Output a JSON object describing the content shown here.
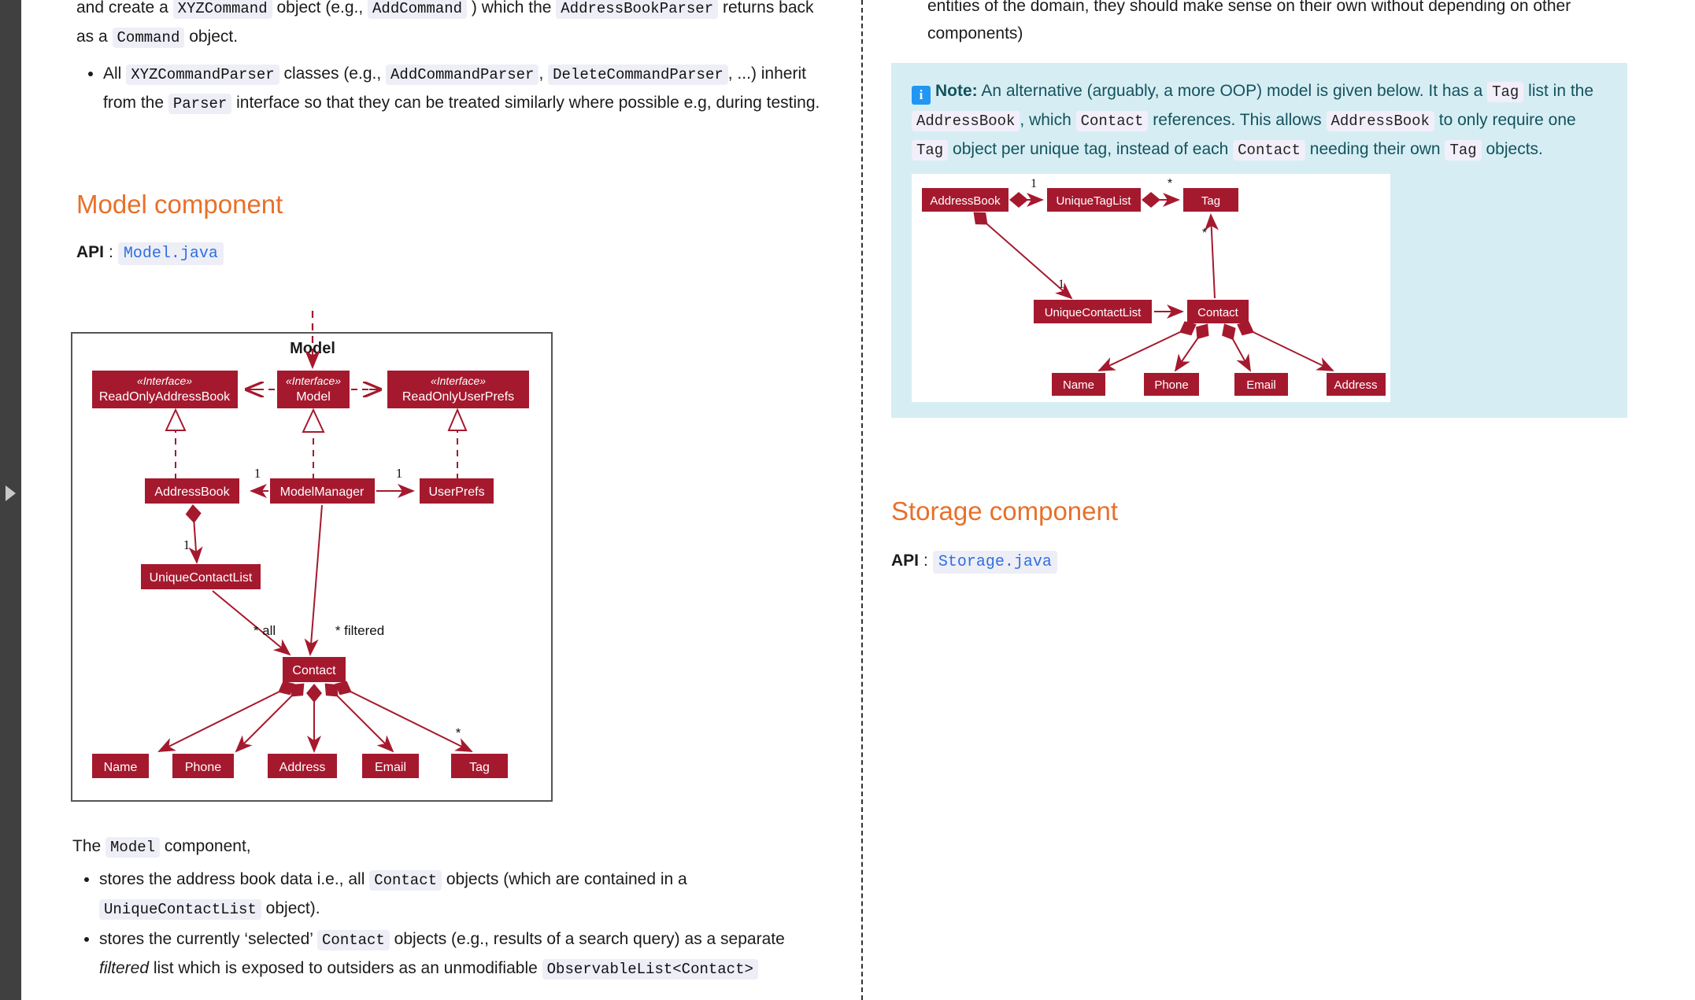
{
  "left_rail": {
    "toggle_icon": "triangle-right-icon"
  },
  "left_column": {
    "intro_paragraph": {
      "t1": "and create a ",
      "c1": "XYZCommand",
      "t2": " object (e.g., ",
      "c2": "AddCommand",
      "t3": " ) which the ",
      "c3": "AddressBookParser",
      "t4": " returns back as a ",
      "c4": "Command",
      "t5": " object."
    },
    "bullet_parser": {
      "t1": "All ",
      "c1": "XYZCommandParser",
      "t2": " classes (e.g., ",
      "c2": "AddCommandParser",
      "t3": ", ",
      "c3": "DeleteCommandParser",
      "t4": ", ...) inherit from the ",
      "c4": "Parser",
      "t5": " interface so that they can be treated similarly where possible e.g, during testing."
    },
    "section_heading": "Model component",
    "api_label": "API",
    "api_sep": ":",
    "api_file": "Model.java",
    "closing_lead": {
      "t1": "The ",
      "c1": "Model",
      "t2": " component,"
    },
    "closing_bullets": [
      {
        "t1": "stores the address book data i.e., all ",
        "c1": "Contact",
        "t2": " objects (which are contained in a ",
        "c2": "UniqueContactList",
        "t3": " object)."
      },
      {
        "t1": "stores the currently ‘selected’ ",
        "c1": "Contact",
        "t2": " objects (e.g., results of a search query) as a separate ",
        "em": "filtered",
        "t3": " list which is exposed to outsiders as an unmodifiable ",
        "c2": "ObservableList<Contact>"
      }
    ]
  },
  "right_column": {
    "top_paragraph": "entities of the domain, they should make sense on their own without depending on other components)",
    "note": {
      "icon": "info-icon",
      "label": "Note:",
      "t1": " An alternative (arguably, a more OOP) model is given below. It has a ",
      "c1": "Tag",
      "t2": " list in the ",
      "c2": "AddressBook",
      "t3": ", which ",
      "c3": "Contact",
      "t4": " references. This allows ",
      "c4": "AddressBook",
      "t5": " to only require one ",
      "c5": "Tag",
      "t6": " object per unique tag, instead of each ",
      "c6": "Contact",
      "t7": " needing their own ",
      "c7": "Tag",
      "t8": " objects."
    },
    "section_heading": "Storage component",
    "api_label": "API",
    "api_sep": ":",
    "api_file": "Storage.java"
  },
  "diagram_model": {
    "frame_title": "Model",
    "classes": {
      "read_only_address_book_stereo": "«Interface»",
      "read_only_address_book": "ReadOnlyAddressBook",
      "model_stereo": "«Interface»",
      "model": "Model",
      "read_only_user_prefs_stereo": "«Interface»",
      "read_only_user_prefs": "ReadOnlyUserPrefs",
      "address_book": "AddressBook",
      "model_manager": "ModelManager",
      "user_prefs": "UserPrefs",
      "unique_contact_list": "UniqueContactList",
      "contact": "Contact",
      "name": "Name",
      "phone": "Phone",
      "address": "Address",
      "email": "Email",
      "tag": "Tag"
    },
    "multiplicities": {
      "mm_ab": "1",
      "mm_up": "1",
      "ab_ucl": "1",
      "all": "* all",
      "filtered": "* filtered",
      "contact_tag": "*"
    },
    "colors": {
      "box_fill": "#a5192e",
      "box_text": "#ffffff",
      "line": "#a5192e",
      "frame": "#555555"
    }
  },
  "diagram_note": {
    "classes": {
      "address_book": "AddressBook",
      "unique_tag_list": "UniqueTagList",
      "tag": "Tag",
      "unique_contact_list": "UniqueContactList",
      "contact": "Contact",
      "name": "Name",
      "phone": "Phone",
      "email": "Email",
      "address": "Address"
    },
    "multiplicities": {
      "ab_utl": "1",
      "utl_tag": "*",
      "ab_ucl": "1",
      "contact_tag": "*"
    },
    "colors": {
      "box_fill": "#a5192e",
      "box_text": "#ffffff",
      "line": "#a5192e",
      "bg": "#ffffff"
    }
  }
}
